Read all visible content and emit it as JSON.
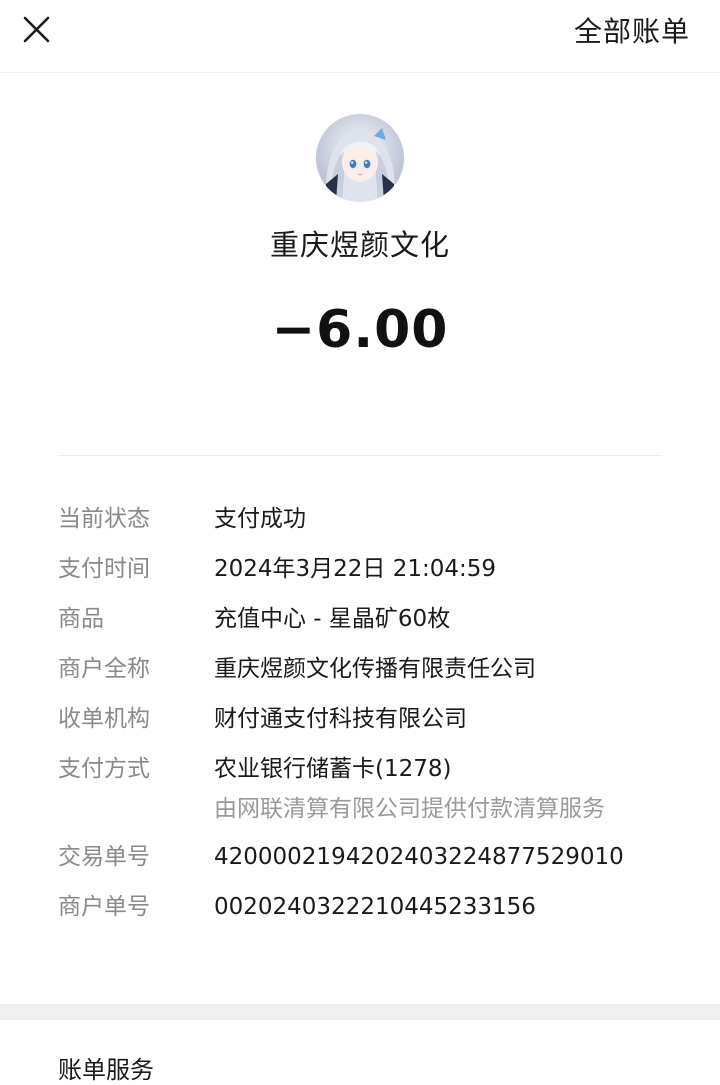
{
  "header": {
    "close_icon": "close-icon",
    "all_bills_label": "全部账单"
  },
  "merchant": {
    "avatar_icon": "anime-avatar",
    "name": "重庆煜颜文化"
  },
  "amount": "−6.00",
  "details": [
    {
      "label": "当前状态",
      "value": "支付成功"
    },
    {
      "label": "支付时间",
      "value": "2024年3月22日 21:04:59"
    },
    {
      "label": "商品",
      "value": "充值中心 - 星晶矿60枚"
    },
    {
      "label": "商户全称",
      "value": "重庆煜颜文化传播有限责任公司"
    },
    {
      "label": "收单机构",
      "value": "财付通支付科技有限公司"
    },
    {
      "label": "支付方式",
      "value": "农业银行储蓄卡(1278)",
      "sub": "由网联清算有限公司提供付款清算服务"
    },
    {
      "label": "交易单号",
      "value": "4200002194202403224877529010"
    },
    {
      "label": "商户单号",
      "value": "0020240322210445233156"
    }
  ],
  "bill_services_label": "账单服务"
}
